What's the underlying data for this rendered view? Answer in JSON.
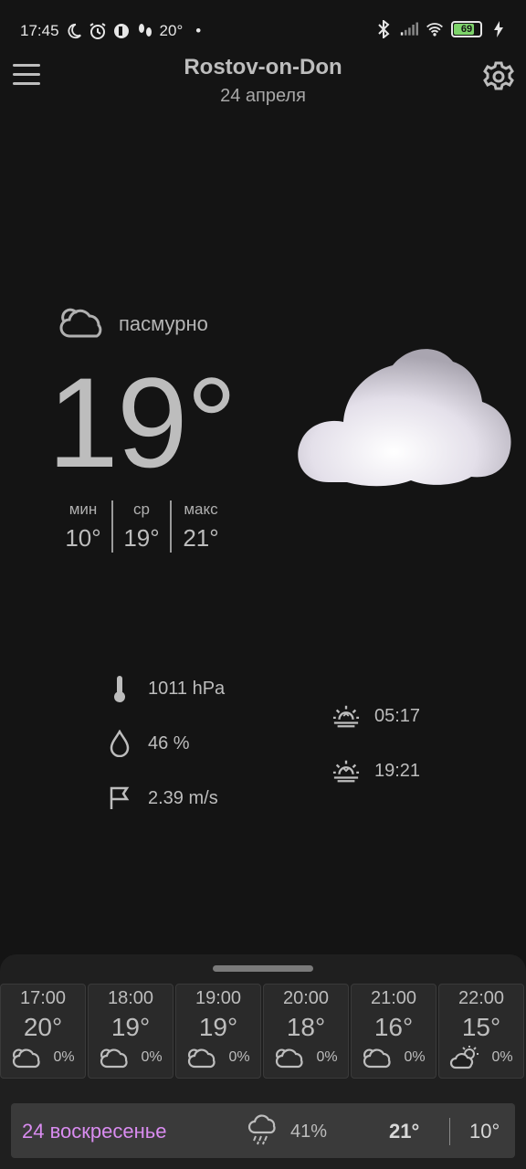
{
  "status_bar": {
    "time": "17:45",
    "temp": "20°",
    "dot": "•",
    "battery": "69",
    "icons": [
      "moon-icon",
      "alarm-icon",
      "app-icon",
      "steps-icon",
      "bluetooth-icon",
      "signal-icon",
      "wifi-icon",
      "battery-icon",
      "charging-icon"
    ]
  },
  "header": {
    "city": "Rostov-on-Don",
    "date": "24 апреля"
  },
  "current": {
    "condition": "пасмурно",
    "temperature": "19°",
    "min_label": "мин",
    "min_value": "10°",
    "avg_label": "ср",
    "avg_value": "19°",
    "max_label": "макс",
    "max_value": "21°"
  },
  "details": {
    "pressure": "1011 hPa",
    "humidity": "46 %",
    "wind": "2.39 m/s",
    "sunrise": "05:17",
    "sunset": "19:21"
  },
  "hourly": [
    {
      "time": "17:00",
      "temp": "20°",
      "precip": "0%",
      "icon": "cloud-icon"
    },
    {
      "time": "18:00",
      "temp": "19°",
      "precip": "0%",
      "icon": "cloud-icon"
    },
    {
      "time": "19:00",
      "temp": "19°",
      "precip": "0%",
      "icon": "cloud-icon"
    },
    {
      "time": "20:00",
      "temp": "18°",
      "precip": "0%",
      "icon": "cloud-icon"
    },
    {
      "time": "21:00",
      "temp": "16°",
      "precip": "0%",
      "icon": "cloud-icon"
    },
    {
      "time": "22:00",
      "temp": "15°",
      "precip": "0%",
      "icon": "partly-cloudy-icon"
    }
  ],
  "daily": [
    {
      "day": "24 воскресенье",
      "precip": "41%",
      "high": "21°",
      "low": "10°",
      "icon": "rain-cloud-icon"
    }
  ],
  "colors": {
    "background": "#141414",
    "text": "#bdbdbd",
    "day_accent": "#d98cf0",
    "battery_green": "#7dd36a"
  }
}
